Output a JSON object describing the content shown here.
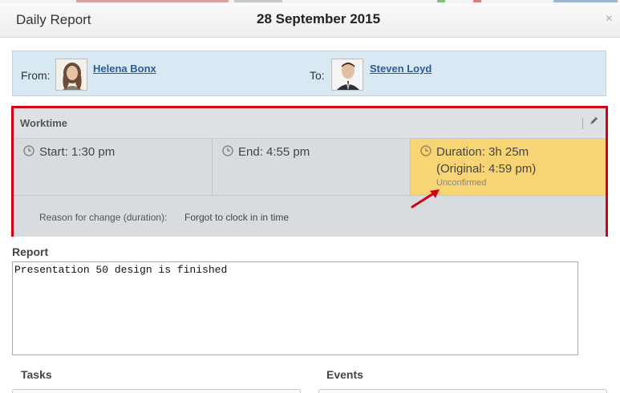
{
  "dialog": {
    "title": "Daily Report",
    "date": "28 September 2015",
    "close": "×"
  },
  "people": {
    "from_label": "From:",
    "from_name": "Helena Bonx",
    "to_label": "To:",
    "to_name": "Steven Loyd"
  },
  "worktime": {
    "title": "Worktime",
    "start": "Start: 1:30 pm",
    "end": "End: 4:55 pm",
    "duration": "Duration: 3h 25m",
    "original": "(Original: 4:59 pm)",
    "status": "Unconfirmed",
    "reason_label": "Reason for change (duration):",
    "reason_value": "Forgot to clock in in time"
  },
  "report": {
    "label": "Report",
    "text": "Presentation 50 design is finished"
  },
  "sections": {
    "tasks": "Tasks",
    "events": "Events"
  },
  "colors": {
    "highlight_border": "#d0021b",
    "duration_bg": "#f8d574",
    "people_bg": "#d9e9f4",
    "link": "#2a5c9a"
  }
}
